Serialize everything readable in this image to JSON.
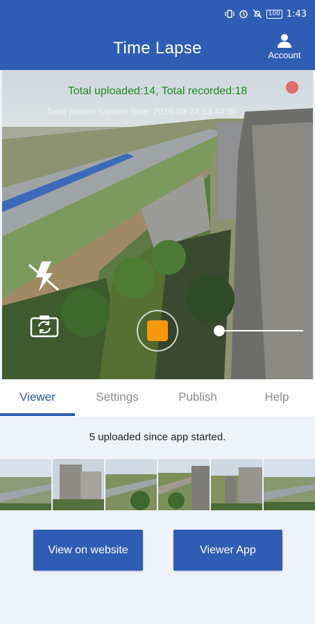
{
  "status_bar": {
    "time": "1:43",
    "battery": "100"
  },
  "header": {
    "title": "Time Lapse",
    "account_label": "Account"
  },
  "camera": {
    "total_text": "Total uploaded:14, Total recorded:18",
    "next_capture_text": "Next picture capture time: 2019-09-24 13:43:30"
  },
  "tabs": [
    "Viewer",
    "Settings",
    "Publish",
    "Help"
  ],
  "viewer": {
    "info_text": "5 uploaded since app started.",
    "btn_website": "View on website",
    "btn_app": "Viewer App"
  },
  "colors": {
    "primary": "#2f5db3",
    "record": "#f5970f",
    "rec_dot": "#e06c6c",
    "status_green": "#1f8a1f"
  }
}
